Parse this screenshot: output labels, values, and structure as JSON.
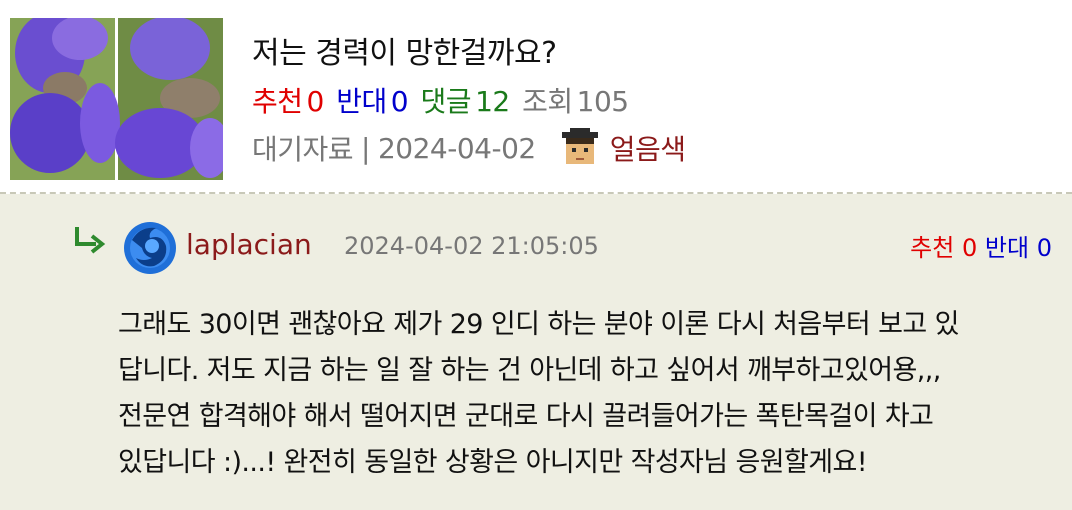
{
  "post": {
    "title": "저는 경력이 망한걸까요?",
    "stats": {
      "recommend_label": "추천",
      "recommend_count": "0",
      "oppose_label": "반대",
      "oppose_count": "0",
      "comments_label": "댓글",
      "comments_count": "12",
      "views_label": "조회",
      "views_count": "105"
    },
    "meta": {
      "category": "대기자료",
      "separator": "|",
      "date": "2024-04-02",
      "author": "얼음색"
    }
  },
  "comment": {
    "author": "laplacian",
    "timestamp": "2024-04-02 21:05:05",
    "recommend_label": "추천",
    "recommend_count": "0",
    "oppose_label": "반대",
    "oppose_count": "0",
    "body_lines": [
      "그래도 30이면 괜찮아요 제가 29 인디 하는 분야 이론 다시 처음부터 보고 있",
      "답니다. 저도 지금 하는 일 잘 하는 건 아닌데 하고 싶어서 깨부하고있어용,,,",
      "전문연 합격해야 해서 떨어지면 군대로 다시 끌려들어가는 폭탄목걸이 차고",
      "있답니다 :)...! 완전히 동일한 상황은 아니지만 작성자님 응원할게요!"
    ]
  },
  "icons": {
    "thumbnail": "iris-flower-thumbnail",
    "level": "pixel-avatar-icon",
    "reply": "reply-arrow-icon",
    "avatar": "firefox-avatar-icon"
  },
  "colors": {
    "recommend": "#e00000",
    "oppose": "#0000cc",
    "comments": "#1a7a1a",
    "author": "#8b1a1a",
    "comment_bg": "#eeeee2"
  }
}
